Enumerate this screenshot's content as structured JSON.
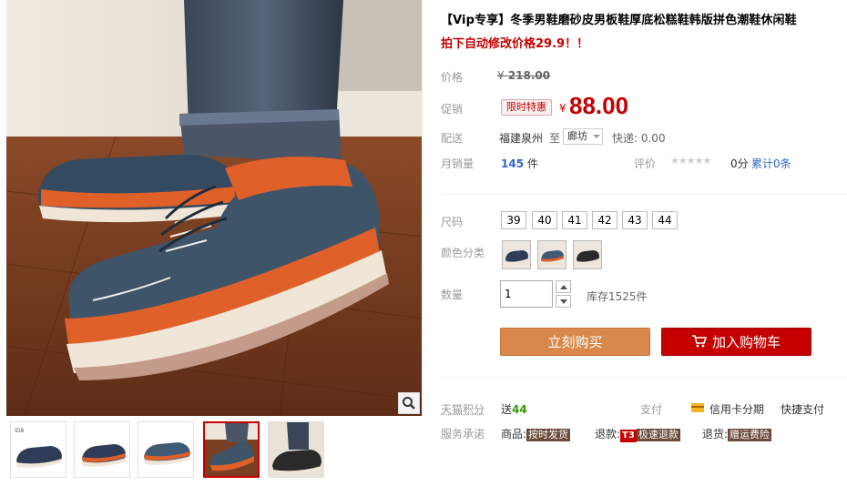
{
  "product": {
    "title": "【Vip专享】冬季男鞋磨砂皮男板鞋厚底松糕鞋韩版拼色潮鞋休闲鞋",
    "subtitle": "拍下自动修改价格29.9！！"
  },
  "price": {
    "label": "价格",
    "currency": "¥",
    "original": "218.00"
  },
  "promo": {
    "label": "促销",
    "tag": "限时特惠",
    "currency": "¥",
    "price": "88.00"
  },
  "shipping": {
    "label": "配送",
    "from": "福建泉州",
    "to_word": "至",
    "destination": "廊坊",
    "fee": "快递: 0.00"
  },
  "sales": {
    "label": "月销量",
    "count": "145",
    "unit": "件",
    "rating_label": "评价",
    "stars": "★★★★★",
    "score": "0分",
    "reviews": "累计0条"
  },
  "size": {
    "label": "尺码",
    "options": [
      "39",
      "40",
      "41",
      "42",
      "43",
      "44"
    ]
  },
  "color": {
    "label": "颜色分类",
    "swatch_colors": [
      "#2f3c58",
      "#3f5a73",
      "#2a2a2a"
    ]
  },
  "quantity": {
    "label": "数量",
    "value": "1",
    "stock": "库存1525件"
  },
  "actions": {
    "buy_now": "立刻购买",
    "add_to_cart": "加入购物车"
  },
  "points": {
    "label": "天猫积分",
    "prefix": "送",
    "amount": "44"
  },
  "payment": {
    "label": "支付",
    "installment": "信用卡分期",
    "quickpay": "快捷支付"
  },
  "service": {
    "label": "服务承诺",
    "goods_prefix": "商品:",
    "goods_badge": "按时发货",
    "refund_prefix": "退款:",
    "refund_t3": "T3",
    "refund_badge": "极速退款",
    "return_prefix": "退货:",
    "return_badge": "赠运费险"
  },
  "gallery": {
    "thumb_count": 5,
    "active_thumb": 4,
    "colors": {
      "suede_blue": "#3e5468",
      "accent_orange": "#e0602a",
      "sole": "#efe6d8",
      "floor": "#7a3f22"
    }
  }
}
